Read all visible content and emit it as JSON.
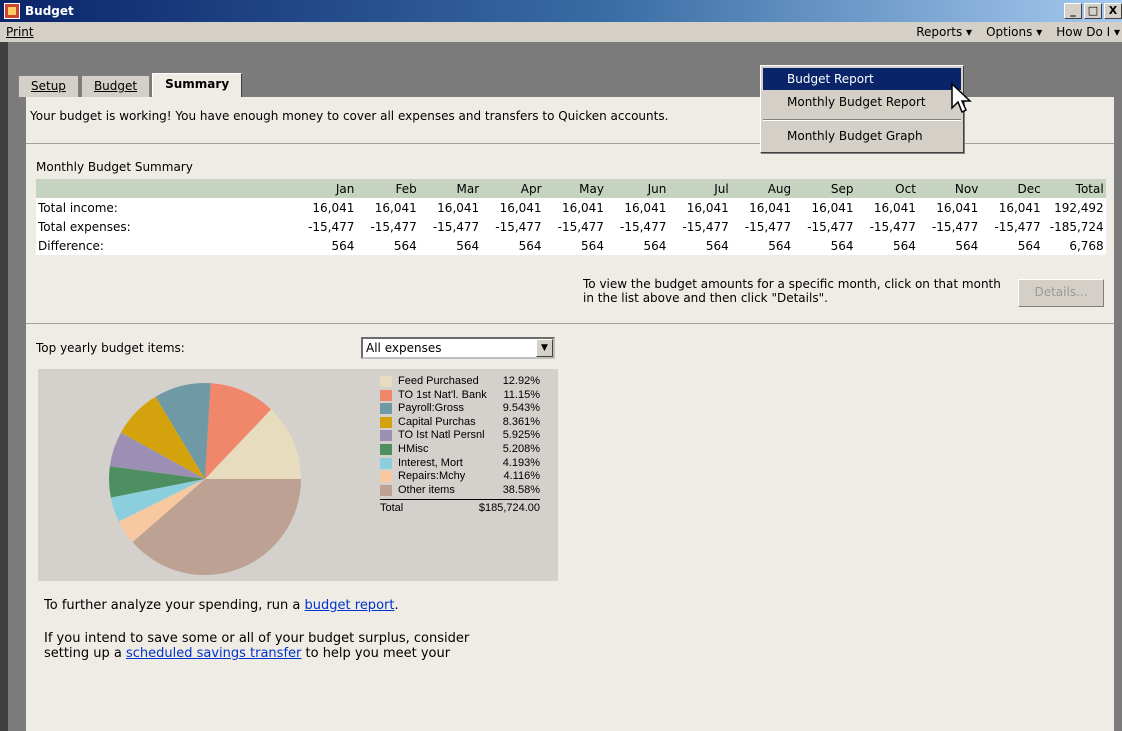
{
  "window": {
    "title": "Budget",
    "buttons": [
      "_",
      "□",
      "X"
    ]
  },
  "menubar": {
    "print": "Print",
    "reports": "Reports ▾",
    "options": "Options ▾",
    "howdoi": "How Do I ▾"
  },
  "tabs": [
    {
      "label": "Setup",
      "active": false
    },
    {
      "label": "Budget",
      "active": false
    },
    {
      "label": "Summary",
      "active": true
    }
  ],
  "status_message": "Your budget is working! You have enough money to cover all expenses and transfers to Quicken accounts.",
  "summary": {
    "title": "Monthly Budget Summary",
    "months": [
      "Jan",
      "Feb",
      "Mar",
      "Apr",
      "May",
      "Jun",
      "Jul",
      "Aug",
      "Sep",
      "Oct",
      "Nov",
      "Dec"
    ],
    "total_header": "Total",
    "rows": [
      {
        "label": "Total income:",
        "values": [
          "16,041",
          "16,041",
          "16,041",
          "16,041",
          "16,041",
          "16,041",
          "16,041",
          "16,041",
          "16,041",
          "16,041",
          "16,041",
          "16,041"
        ],
        "total": "192,492"
      },
      {
        "label": "Total expenses:",
        "values": [
          "-15,477",
          "-15,477",
          "-15,477",
          "-15,477",
          "-15,477",
          "-15,477",
          "-15,477",
          "-15,477",
          "-15,477",
          "-15,477",
          "-15,477",
          "-15,477"
        ],
        "total": "-185,724"
      },
      {
        "label": "Difference:",
        "values": [
          "564",
          "564",
          "564",
          "564",
          "564",
          "564",
          "564",
          "564",
          "564",
          "564",
          "564",
          "564"
        ],
        "total": "6,768"
      }
    ]
  },
  "hint": "To view the budget amounts for a specific month, click on that month in the list above and then click \"Details\".",
  "details_button": "Details...",
  "top_items": {
    "label": "Top yearly budget items:",
    "select_value": "All expenses",
    "legend": [
      {
        "name": "Feed Purchased",
        "pct": "12.92%",
        "value": 12.92,
        "color": "#e8dcbf"
      },
      {
        "name": "TO 1st Nat'l. Bank",
        "pct": "11.15%",
        "value": 11.15,
        "color": "#f0866a"
      },
      {
        "name": "Payroll:Gross",
        "pct": "9.543%",
        "value": 9.543,
        "color": "#6f9aa5"
      },
      {
        "name": "Capital Purchas",
        "pct": "8.361%",
        "value": 8.361,
        "color": "#d4a20d"
      },
      {
        "name": "TO Ist Natl Persnl",
        "pct": "5.925%",
        "value": 5.925,
        "color": "#9c8fb4"
      },
      {
        "name": "HMisc",
        "pct": "5.208%",
        "value": 5.208,
        "color": "#4e8f62"
      },
      {
        "name": "Interest, Mort",
        "pct": "4.193%",
        "value": 4.193,
        "color": "#8ccfdc"
      },
      {
        "name": "Repairs:Mchy",
        "pct": "4.116%",
        "value": 4.116,
        "color": "#f8c9a0"
      },
      {
        "name": "Other items",
        "pct": "38.58%",
        "value": 38.58,
        "color": "#bda193"
      }
    ],
    "total_label": "Total",
    "total_value": "$185,724.00"
  },
  "analyze_text": {
    "prefix": "To further analyze your spending, run a ",
    "link": "budget report",
    "suffix": "."
  },
  "surplus_text": {
    "line1": "If you intend to save some or all of your budget surplus, consider",
    "prefix": "setting up a ",
    "link": "scheduled savings transfer",
    "suffix": " to help you meet your"
  },
  "reports_menu": {
    "items": [
      "Budget Report",
      "Monthly Budget Report",
      "Monthly Budget Graph"
    ],
    "selected": "Budget Report"
  }
}
